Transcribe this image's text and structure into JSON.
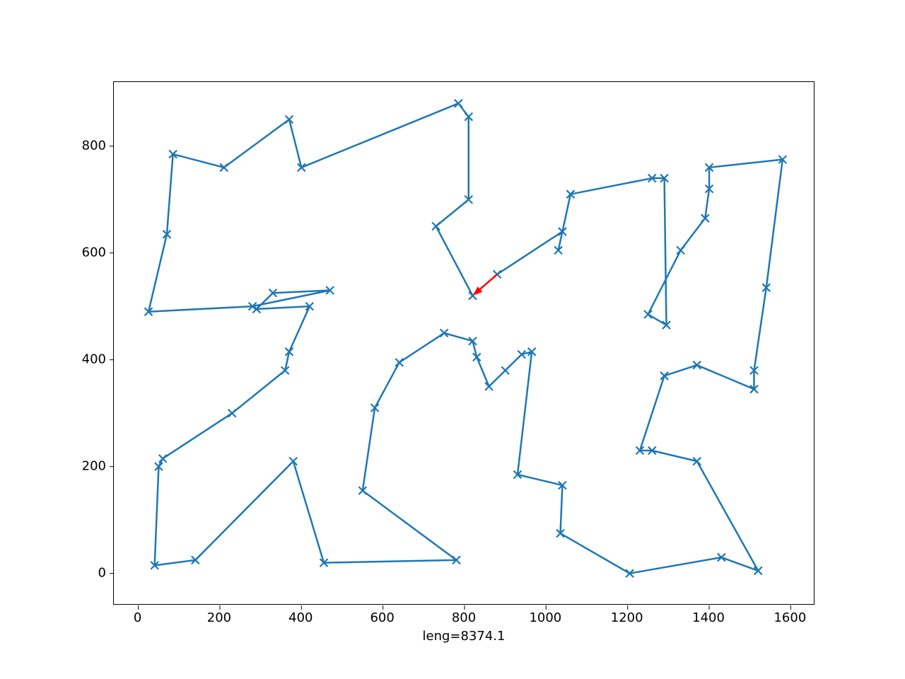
{
  "chart_data": {
    "type": "line",
    "xlabel": "leng=8374.1",
    "ylabel": "",
    "xlim": [
      -60,
      1660
    ],
    "ylim": [
      -60,
      920
    ],
    "xticks": [
      0,
      200,
      400,
      600,
      800,
      1000,
      1200,
      1400,
      1600
    ],
    "yticks": [
      0,
      200,
      400,
      600,
      800
    ],
    "colors": {
      "line": "#1f77b4",
      "marker": "#1f77b4",
      "arrow": "#ff0000"
    },
    "arrow": {
      "from": [
        880,
        560
      ],
      "to": [
        820,
        520
      ]
    },
    "path": [
      [
        880,
        560
      ],
      [
        1040,
        640
      ],
      [
        1030,
        605
      ],
      [
        1060,
        710
      ],
      [
        1260,
        740
      ],
      [
        1290,
        740
      ],
      [
        1295,
        465
      ],
      [
        1250,
        485
      ],
      [
        1330,
        605
      ],
      [
        1390,
        665
      ],
      [
        1400,
        720
      ],
      [
        1400,
        760
      ],
      [
        1580,
        775
      ],
      [
        1540,
        535
      ],
      [
        1510,
        380
      ],
      [
        1510,
        345
      ],
      [
        1370,
        390
      ],
      [
        1290,
        370
      ],
      [
        1230,
        230
      ],
      [
        1260,
        230
      ],
      [
        1370,
        210
      ],
      [
        1520,
        5
      ],
      [
        1430,
        30
      ],
      [
        1205,
        0
      ],
      [
        1035,
        75
      ],
      [
        1040,
        165
      ],
      [
        930,
        185
      ],
      [
        965,
        415
      ],
      [
        940,
        410
      ],
      [
        900,
        380
      ],
      [
        860,
        350
      ],
      [
        830,
        405
      ],
      [
        820,
        435
      ],
      [
        750,
        450
      ],
      [
        640,
        395
      ],
      [
        580,
        310
      ],
      [
        550,
        155
      ],
      [
        780,
        25
      ],
      [
        455,
        20
      ],
      [
        380,
        210
      ],
      [
        140,
        25
      ],
      [
        40,
        15
      ],
      [
        50,
        200
      ],
      [
        60,
        215
      ],
      [
        230,
        300
      ],
      [
        360,
        380
      ],
      [
        370,
        415
      ],
      [
        420,
        500
      ],
      [
        290,
        495
      ],
      [
        330,
        525
      ],
      [
        470,
        530
      ],
      [
        280,
        500
      ],
      [
        25,
        490
      ],
      [
        70,
        635
      ],
      [
        85,
        785
      ],
      [
        210,
        760
      ],
      [
        370,
        850
      ],
      [
        400,
        760
      ],
      [
        785,
        880
      ],
      [
        810,
        855
      ],
      [
        810,
        700
      ],
      [
        730,
        650
      ],
      [
        820,
        520
      ]
    ]
  }
}
